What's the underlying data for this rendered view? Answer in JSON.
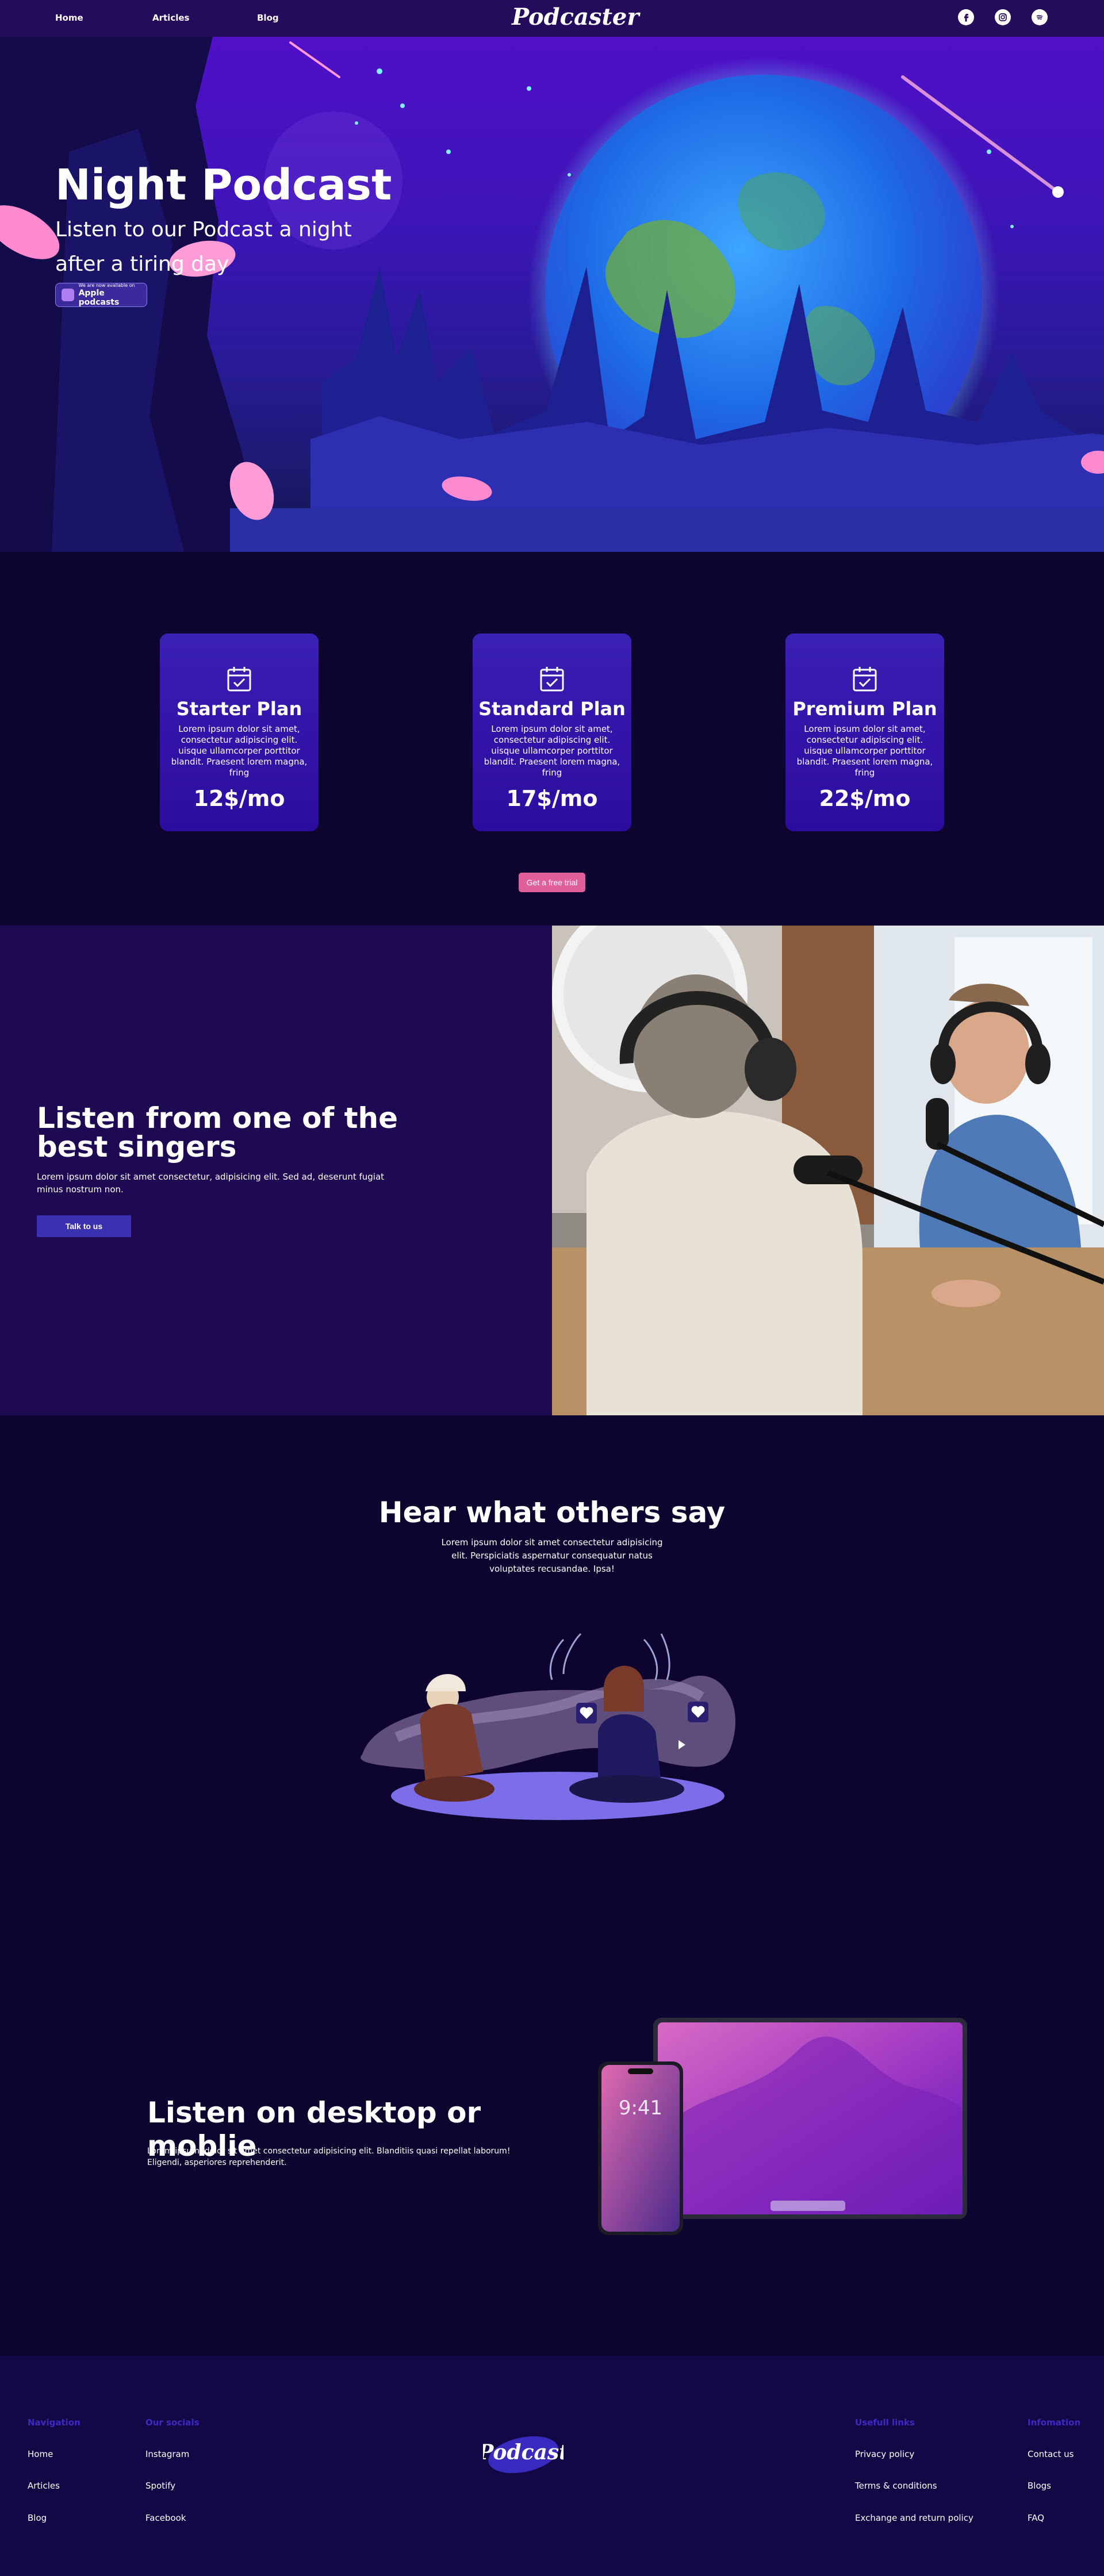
{
  "nav": {
    "home": "Home",
    "articles": "Articles",
    "blog": "Blog",
    "logo": "Podcaster"
  },
  "hero": {
    "title": "Night Podcast",
    "subtitle": "Listen to our Podcast a night after a tiring day",
    "badge_small": "We are now available on",
    "badge_main": "Apple podcasts"
  },
  "plans": [
    {
      "name": "Starter Plan",
      "desc": "Lorem ipsum dolor sit amet, consectetur adipiscing elit. uisque ullamcorper porttitor blandit. Praesent lorem magna, fring",
      "price": "12$/mo"
    },
    {
      "name": "Standard Plan",
      "desc": "Lorem ipsum dolor sit amet, consectetur adipiscing elit. uisque ullamcorper porttitor blandit. Praesent lorem magna, fring",
      "price": "17$/mo"
    },
    {
      "name": "Premium Plan",
      "desc": "Lorem ipsum dolor sit amet, consectetur adipiscing elit. uisque ullamcorper porttitor blandit. Praesent lorem magna, fring",
      "price": "22$/mo"
    }
  ],
  "trial_button": "Get a free trial",
  "singers": {
    "title": "Listen from one of the best singers",
    "text": "Lorem ipsum dolor sit amet consectetur, adipisicing elit. Sed ad, deserunt fugiat minus nostrum non.",
    "button": "Talk to us"
  },
  "hear": {
    "title": "Hear what others say",
    "text": "Lorem ipsum dolor sit amet consectetur adipisicing elit. Perspiciatis aspernatur consequatur natus voluptates recusandae. Ipsa!"
  },
  "desktop": {
    "title": "Listen on desktop or moblie",
    "text": "Lorem ipsum, dolor sit amet consectetur adipisicing elit. Blanditiis quasi repellat laborum! Eligendi, asperiores reprehenderit.",
    "phone_time": "9:41"
  },
  "footer": {
    "logo": "Podcast",
    "navigation": {
      "heading": "Navigation",
      "links": [
        "Home",
        "Articles",
        "Blog"
      ]
    },
    "socials": {
      "heading": "Our socials",
      "links": [
        "Instagram",
        "Spotify",
        "Facebook"
      ]
    },
    "useful": {
      "heading": "Usefull links",
      "links": [
        "Privacy policy",
        "Terms & conditions",
        "Exchange and return policy"
      ]
    },
    "information": {
      "heading": "Infomation",
      "links": [
        "Contact us",
        "Blogs",
        "FAQ"
      ]
    }
  },
  "icons": {
    "social": [
      "facebook-icon",
      "instagram-icon",
      "spotify-icon"
    ],
    "plan": "calendar-check-icon"
  },
  "colors": {
    "background": "#0d0530",
    "nav": "#240b5c",
    "card": "#3213a8",
    "trial": "#e0609c",
    "talk": "#3a30b0",
    "footer_heading": "#3b2bc4"
  }
}
